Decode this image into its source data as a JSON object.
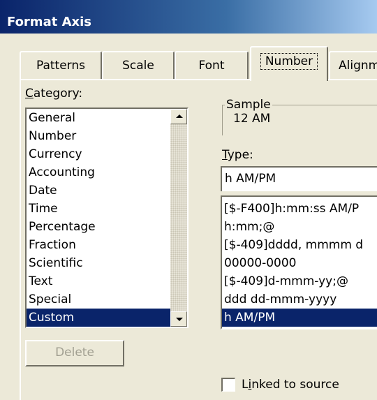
{
  "window": {
    "title": "Format Axis"
  },
  "tabs": [
    {
      "label": "Patterns"
    },
    {
      "label": "Scale"
    },
    {
      "label": "Font"
    },
    {
      "label": "Number"
    },
    {
      "label": "Alignm"
    }
  ],
  "category": {
    "label_first": "C",
    "label_rest": "ategory:",
    "items": [
      "General",
      "Number",
      "Currency",
      "Accounting",
      "Date",
      "Time",
      "Percentage",
      "Fraction",
      "Scientific",
      "Text",
      "Special",
      "Custom"
    ],
    "selected": "Custom"
  },
  "sample": {
    "legend": "Sample",
    "value": "12 AM"
  },
  "type": {
    "label_first": "T",
    "label_rest": "ype:",
    "value": "h AM/PM",
    "items": [
      "[$-F400]h:mm:ss AM/P",
      "h:mm;@",
      "[$-409]dddd, mmmm d",
      "00000-0000",
      "[$-409]d-mmm-yy;@",
      "ddd dd-mmm-yyyy",
      "h AM/PM"
    ],
    "selected": "h AM/PM"
  },
  "buttons": {
    "delete_label": "Delete"
  },
  "linked": {
    "label_first": "L",
    "label_u": "i",
    "label_rest": "nked to source",
    "checked": false
  }
}
